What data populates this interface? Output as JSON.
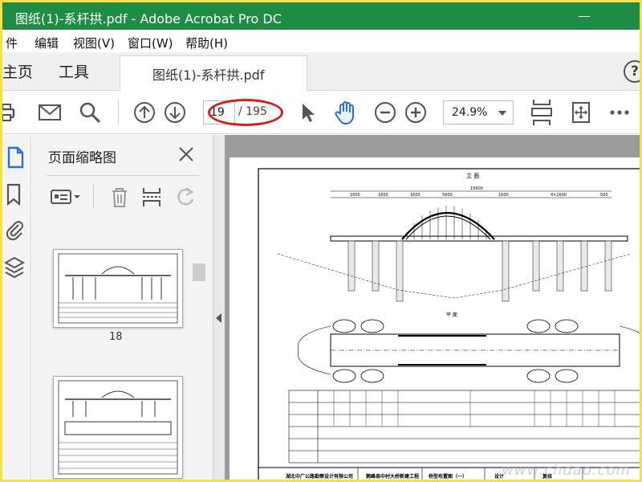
{
  "window": {
    "title": "图纸(1)-系杆拱.pdf - Adobe Acrobat Pro DC"
  },
  "menu": [
    "件",
    "编辑",
    "视图(V)",
    "窗口(W)",
    "帮助(H)"
  ],
  "tabs": {
    "home": "主页",
    "tools": "工具",
    "document": "图纸(1)-系杆拱.pdf",
    "help": "?"
  },
  "toolbar": {
    "page_current": "19",
    "page_total": "/ 195",
    "zoom": "24.9%"
  },
  "thumbnails": {
    "title": "页面缩略图",
    "pages": [
      {
        "label": "18"
      }
    ]
  },
  "drawing": {
    "title_top": "立 面",
    "title_plan": "平 面",
    "company": "湖北中广公路勘察设计有限公司",
    "project": "鹅峰县中村大桥新建工程",
    "sheet": "桥型布置图（一）",
    "design_label": "设计",
    "review_label": "复核",
    "dims": [
      "1600",
      "1600",
      "1600",
      "5000",
      "1600",
      "4×1600",
      "500",
      "15600"
    ]
  },
  "watermark": "www.chdao.com",
  "colors": {
    "titlebar": "#1e8c45",
    "highlight": "#d91e1e",
    "accent_blue": "#2d6fd8"
  }
}
